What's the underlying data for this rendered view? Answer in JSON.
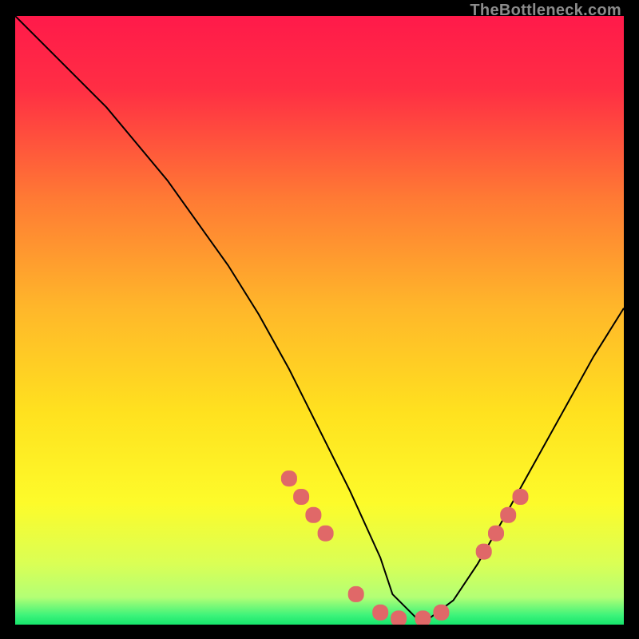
{
  "watermark": "TheBottleneck.com",
  "chart_data": {
    "type": "line",
    "title": "",
    "xlabel": "",
    "ylabel": "",
    "xlim": [
      0,
      100
    ],
    "ylim": [
      0,
      100
    ],
    "series": [
      {
        "name": "bottleneck-curve",
        "x": [
          0,
          5,
          10,
          15,
          20,
          25,
          30,
          35,
          40,
          45,
          50,
          55,
          60,
          62,
          66,
          68,
          72,
          76,
          80,
          85,
          90,
          95,
          100
        ],
        "values": [
          100,
          95,
          90,
          85,
          79,
          73,
          66,
          59,
          51,
          42,
          32,
          22,
          11,
          5,
          1,
          1,
          4,
          10,
          17,
          26,
          35,
          44,
          52
        ]
      }
    ],
    "markers": {
      "name": "highlighted-points",
      "x": [
        45,
        47,
        49,
        51,
        56,
        60,
        63,
        67,
        70,
        77,
        79,
        81,
        83
      ],
      "values": [
        24,
        21,
        18,
        15,
        5,
        2,
        1,
        1,
        2,
        12,
        15,
        18,
        21
      ]
    },
    "gradient_stops": [
      {
        "offset": 0.0,
        "color": "#ff1a4a"
      },
      {
        "offset": 0.12,
        "color": "#ff2e44"
      },
      {
        "offset": 0.3,
        "color": "#ff7a34"
      },
      {
        "offset": 0.48,
        "color": "#ffb72a"
      },
      {
        "offset": 0.65,
        "color": "#ffe11f"
      },
      {
        "offset": 0.8,
        "color": "#fdfb2a"
      },
      {
        "offset": 0.9,
        "color": "#daff55"
      },
      {
        "offset": 0.955,
        "color": "#b3ff75"
      },
      {
        "offset": 0.985,
        "color": "#3cf37a"
      },
      {
        "offset": 1.0,
        "color": "#16e56c"
      }
    ],
    "marker_color": "#e06868",
    "curve_color": "#000000"
  }
}
